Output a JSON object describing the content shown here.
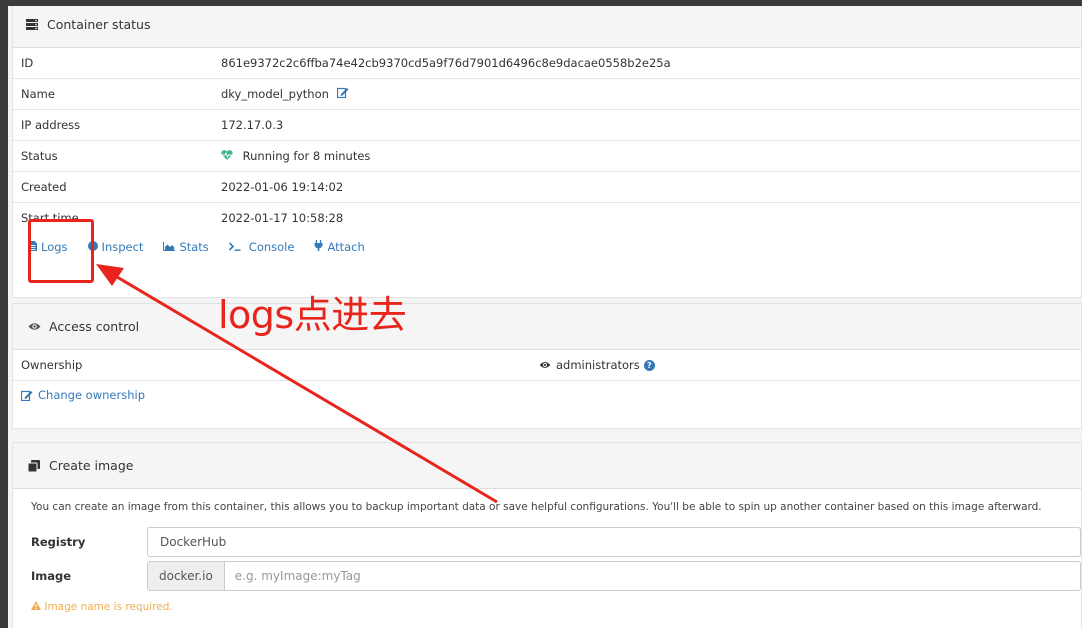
{
  "container_status": {
    "title": "Container status",
    "rows": [
      {
        "key": "ID",
        "value": "861e9372c2c6ffba74e42cb9370cd5a9f76d7901d6496c8e9dacae0558b2e25a"
      },
      {
        "key": "Name",
        "value": "dky_model_python"
      },
      {
        "key": "IP address",
        "value": "172.17.0.3"
      },
      {
        "key": "Status",
        "value": "Running for 8 minutes"
      },
      {
        "key": "Created",
        "value": "2022-01-06 19:14:02"
      },
      {
        "key": "Start time",
        "value": "2022-01-17 10:58:28"
      }
    ],
    "actions": [
      "Logs",
      "Inspect",
      "Stats",
      "Console",
      "Attach"
    ]
  },
  "access_control": {
    "title": "Access control",
    "ownership_label": "Ownership",
    "ownership_value": "administrators",
    "change_ownership": "Change ownership"
  },
  "create_image": {
    "title": "Create image",
    "description": "You can create an image from this container, this allows you to backup important data or save helpful configurations. You'll be able to spin up another container based on this image afterward.",
    "registry_label": "Registry",
    "registry_value": "DockerHub",
    "image_label": "Image",
    "image_prefix": "docker.io",
    "image_placeholder": "e.g. myImage:myTag",
    "warning": "Image name is required."
  },
  "annotation": {
    "text": "logs点进去",
    "color": "#e8241d"
  },
  "colors": {
    "link": "#337ab7",
    "status_heart": "#3fb68b",
    "warning": "#f0ad4e"
  },
  "icons": [
    "server-icon",
    "edit-icon",
    "heartbeat-icon",
    "file-icon",
    "info-circle-icon",
    "chart-area-icon",
    "terminal-icon",
    "plug-icon",
    "eye-icon",
    "help-icon",
    "clone-icon",
    "warning-icon"
  ]
}
